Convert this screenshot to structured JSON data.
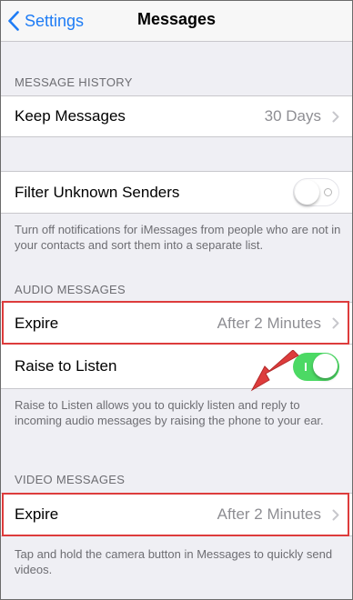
{
  "navbar": {
    "back_label": "Settings",
    "title": "Messages"
  },
  "message_history": {
    "header": "MESSAGE HISTORY",
    "keep_messages": {
      "label": "Keep Messages",
      "value": "30 Days"
    }
  },
  "filter": {
    "label": "Filter Unknown Senders",
    "state": "off",
    "footer": "Turn off notifications for iMessages from people who are not in your contacts and sort them into a separate list."
  },
  "audio_messages": {
    "header": "AUDIO MESSAGES",
    "expire": {
      "label": "Expire",
      "value": "After 2 Minutes"
    },
    "raise_to_listen": {
      "label": "Raise to Listen",
      "state": "on"
    },
    "footer": "Raise to Listen allows you to quickly listen and reply to incoming audio messages by raising the phone to your ear."
  },
  "video_messages": {
    "header": "VIDEO MESSAGES",
    "expire": {
      "label": "Expire",
      "value": "After 2 Minutes"
    },
    "footer": "Tap and hold the camera button in Messages to quickly send videos."
  },
  "colors": {
    "accent": "#1e7cf5",
    "toggle_on": "#4cd964",
    "annotation_red": "#dd3c3c"
  }
}
